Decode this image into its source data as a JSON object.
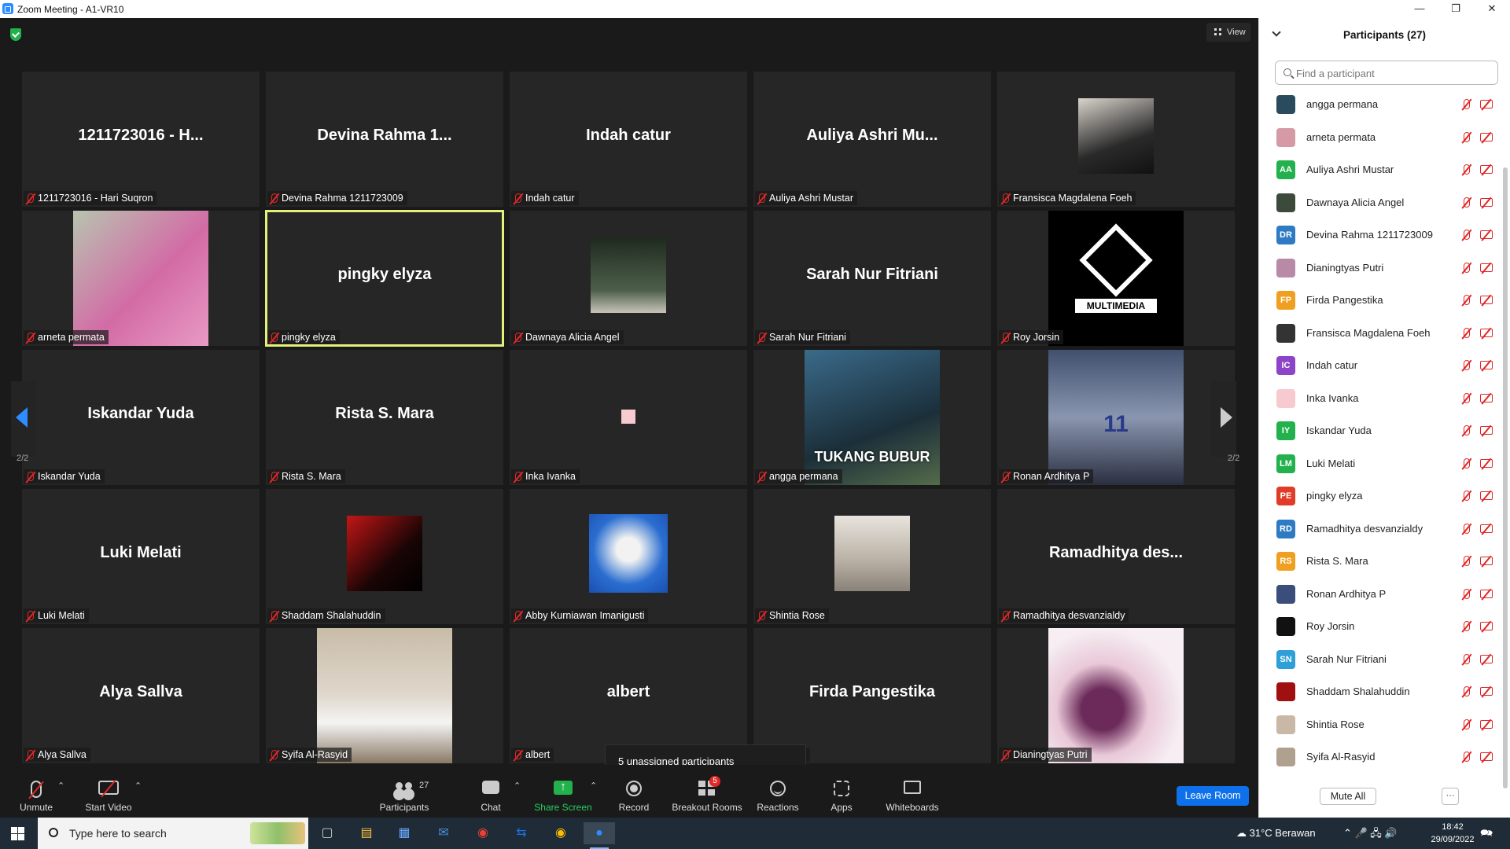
{
  "window": {
    "title": "Zoom Meeting - A1-VR10"
  },
  "meeting": {
    "view_label": "View",
    "page_left": "2/2",
    "page_right": "2/2",
    "tooltip": "5 unassigned participants",
    "tiles": [
      {
        "big": "1211723016 - H...",
        "name": "1211723016 - Hari Suqron"
      },
      {
        "big": "Devina Rahma 1...",
        "name": "Devina Rahma 1211723009"
      },
      {
        "big": "Indah catur",
        "name": "Indah catur"
      },
      {
        "big": "Auliya Ashri Mu...",
        "name": "Auliya Ashri Mustar"
      },
      {
        "big": "",
        "name": "Fransisca Magdalena Foeh"
      },
      {
        "big": "",
        "name": "arneta permata"
      },
      {
        "big": "pingky elyza",
        "name": "pingky elyza"
      },
      {
        "big": "",
        "name": "Dawnaya Alicia Angel"
      },
      {
        "big": "Sarah Nur Fitriani",
        "name": "Sarah Nur Fitriani"
      },
      {
        "big": "",
        "name": "Roy Jorsin",
        "logo_text": "MULTIMEDIA"
      },
      {
        "big": "Iskandar Yuda",
        "name": "Iskandar Yuda"
      },
      {
        "big": "Rista S. Mara",
        "name": "Rista S. Mara"
      },
      {
        "big": "",
        "name": "Inka Ivanka"
      },
      {
        "big": "",
        "name": "angga permana",
        "photo_text": "TUKANG BUBUR"
      },
      {
        "big": "",
        "name": "Ronan Ardhitya P",
        "photo_text": "11"
      },
      {
        "big": "Luki Melati",
        "name": "Luki Melati"
      },
      {
        "big": "",
        "name": "Shaddam Shalahuddin"
      },
      {
        "big": "",
        "name": "Abby Kurniawan Imanigusti"
      },
      {
        "big": "",
        "name": "Shintia Rose"
      },
      {
        "big": "Ramadhitya des...",
        "name": "Ramadhitya desvanzialdy"
      },
      {
        "big": "Alya Sallva",
        "name": "Alya Sallva"
      },
      {
        "big": "",
        "name": "Syifa Al-Rasyid"
      },
      {
        "big": "albert",
        "name": "albert"
      },
      {
        "big": "Firda Pangestika",
        "name": "ngestika"
      },
      {
        "big": "",
        "name": "Dianingtyas Putri"
      }
    ]
  },
  "controls": {
    "unmute": "Unmute",
    "start_video": "Start Video",
    "participants": "Participants",
    "participants_count": "27",
    "chat": "Chat",
    "share": "Share Screen",
    "record": "Record",
    "breakout": "Breakout Rooms",
    "breakout_badge": "5",
    "reactions": "Reactions",
    "apps": "Apps",
    "whiteboards": "Whiteboards",
    "leave": "Leave Room"
  },
  "sidebar": {
    "title": "Participants (27)",
    "search_placeholder": "Find a participant",
    "mute_all": "Mute All",
    "more": "···",
    "participants": [
      {
        "name": "angga permana",
        "initials": "",
        "color": "#2a4a5e"
      },
      {
        "name": "arneta permata",
        "initials": "",
        "color": "#d69aa6"
      },
      {
        "name": "Auliya Ashri Mustar",
        "initials": "AA",
        "color": "#23b14d"
      },
      {
        "name": "Dawnaya Alicia Angel",
        "initials": "",
        "color": "#3c4a3c"
      },
      {
        "name": "Devina Rahma 1211723009",
        "initials": "DR",
        "color": "#2e7bc4"
      },
      {
        "name": "Dianingtyas Putri",
        "initials": "",
        "color": "#b98aa8"
      },
      {
        "name": "Firda Pangestika",
        "initials": "FP",
        "color": "#f0a020"
      },
      {
        "name": "Fransisca Magdalena Foeh",
        "initials": "",
        "color": "#333333"
      },
      {
        "name": "Indah catur",
        "initials": "IC",
        "color": "#8e44c8"
      },
      {
        "name": "Inka Ivanka",
        "initials": "",
        "color": "#f7cad0"
      },
      {
        "name": "Iskandar Yuda",
        "initials": "IY",
        "color": "#23b14d"
      },
      {
        "name": "Luki Melati",
        "initials": "LM",
        "color": "#23b14d"
      },
      {
        "name": "pingky elyza",
        "initials": "PE",
        "color": "#e03c28"
      },
      {
        "name": "Ramadhitya desvanzialdy",
        "initials": "RD",
        "color": "#2e7bc4"
      },
      {
        "name": "Rista S. Mara",
        "initials": "RS",
        "color": "#f0a020"
      },
      {
        "name": "Ronan Ardhitya P",
        "initials": "",
        "color": "#3b4d7a"
      },
      {
        "name": "Roy Jorsin",
        "initials": "",
        "color": "#111111"
      },
      {
        "name": "Sarah Nur Fitriani",
        "initials": "SN",
        "color": "#2e9fd8"
      },
      {
        "name": "Shaddam Shalahuddin",
        "initials": "",
        "color": "#a01010"
      },
      {
        "name": "Shintia Rose",
        "initials": "",
        "color": "#c9b8a6"
      },
      {
        "name": "Syifa Al-Rasyid",
        "initials": "",
        "color": "#b0a090"
      }
    ]
  },
  "taskbar": {
    "search_placeholder": "Type here to search",
    "weather": "31°C Berawan",
    "time": "18:42",
    "date": "29/09/2022"
  }
}
